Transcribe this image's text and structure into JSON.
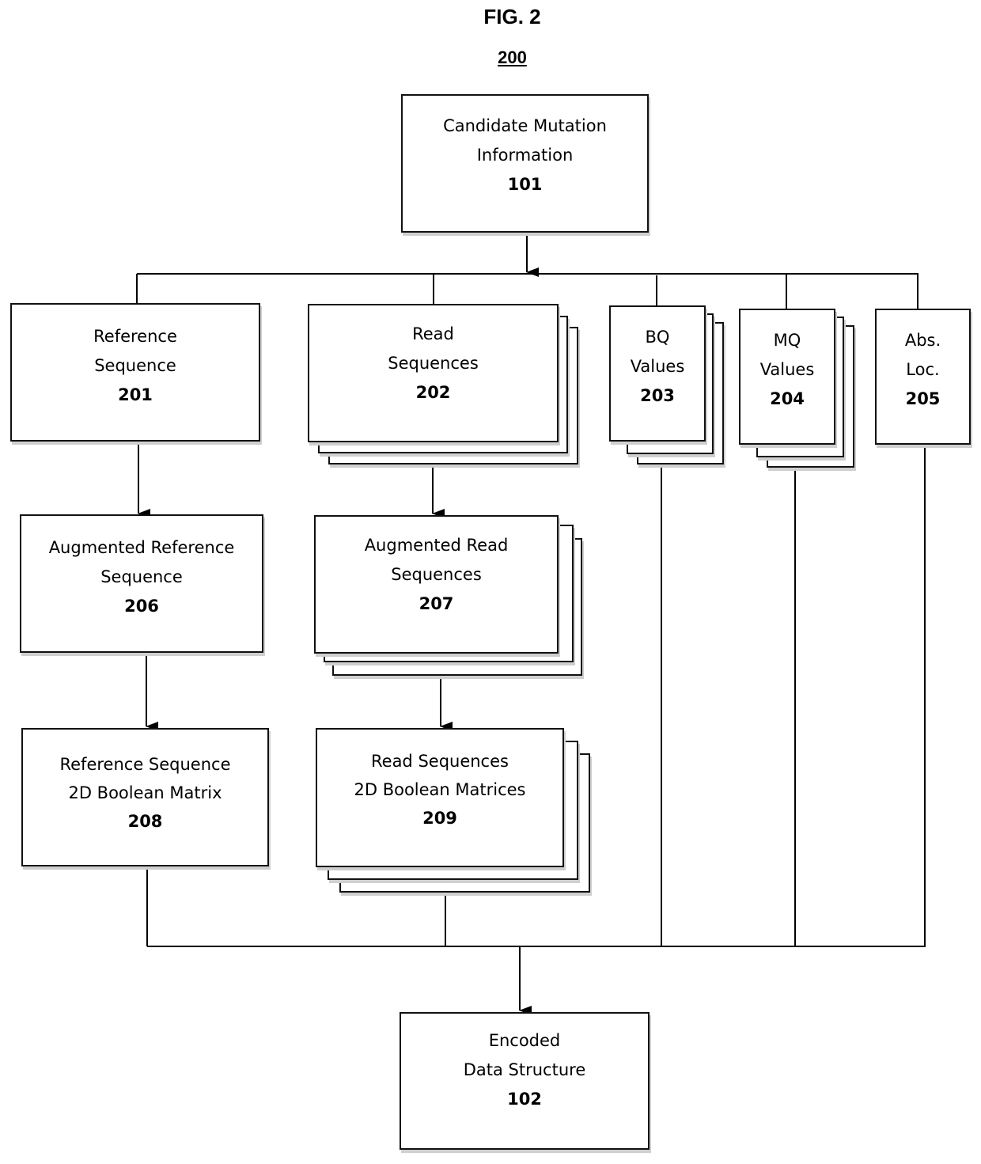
{
  "figure": {
    "title": "FIG. 2",
    "number": "200"
  },
  "nodes": {
    "candidate": {
      "label": "Candidate Mutation\nInformation",
      "ref": "101"
    },
    "reference_sequence": {
      "label": "Reference\nSequence",
      "ref": "201"
    },
    "read_sequences": {
      "label": "Read\nSequences",
      "ref": "202",
      "stacked": true
    },
    "bq_values": {
      "label": "BQ\nValues",
      "ref": "203",
      "stacked": true
    },
    "mq_values": {
      "label": "MQ\nValues",
      "ref": "204",
      "stacked": true
    },
    "abs_loc": {
      "label": "Abs.\nLoc.",
      "ref": "205"
    },
    "augmented_reference": {
      "label": "Augmented Reference\nSequence",
      "ref": "206"
    },
    "augmented_read": {
      "label": "Augmented Read\nSequences",
      "ref": "207",
      "stacked": true
    },
    "reference_matrix": {
      "label": "Reference Sequence\n2D Boolean Matrix",
      "ref": "208"
    },
    "read_matrices": {
      "label": "Read Sequences\n2D Boolean Matrices",
      "ref": "209",
      "stacked": true
    },
    "encoded": {
      "label": "Encoded\nData Structure",
      "ref": "102"
    }
  },
  "edges": [
    {
      "from": "101",
      "to": [
        "201",
        "202",
        "203",
        "204",
        "205"
      ]
    },
    {
      "from": "201",
      "to": [
        "206"
      ]
    },
    {
      "from": "202",
      "to": [
        "207"
      ]
    },
    {
      "from": "206",
      "to": [
        "208"
      ]
    },
    {
      "from": "207",
      "to": [
        "209"
      ]
    },
    {
      "from": [
        "208",
        "209",
        "203",
        "204",
        "205"
      ],
      "to": "102"
    }
  ]
}
